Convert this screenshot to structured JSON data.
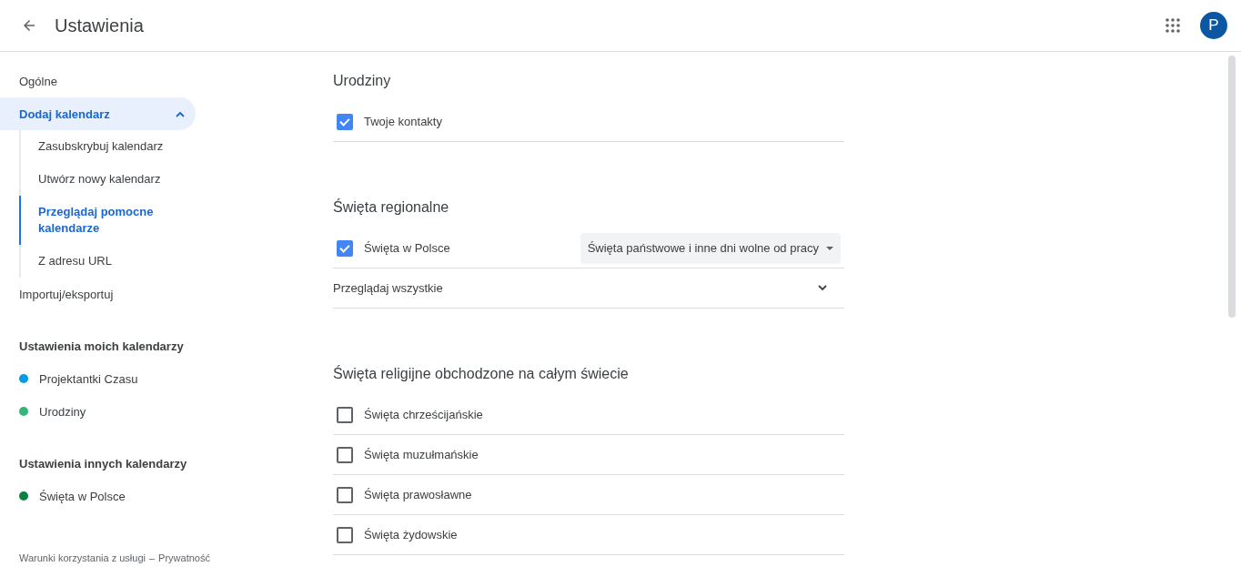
{
  "header": {
    "title": "Ustawienia",
    "avatar": "P"
  },
  "sidebar": {
    "items": [
      {
        "kind": "link",
        "label": "Ogólne",
        "selected": false
      },
      {
        "kind": "group",
        "label": "Dodaj kalendarz",
        "selected": true,
        "expanded": true,
        "children": [
          {
            "label": "Zasubskrybuj kalendarz",
            "selected": false
          },
          {
            "label": "Utwórz nowy kalendarz",
            "selected": false
          },
          {
            "label": "Przeglądaj pomocne kalendarze",
            "selected": true
          },
          {
            "label": "Z adresu URL",
            "selected": false
          }
        ]
      },
      {
        "kind": "link",
        "label": "Importuj/eksportuj",
        "selected": false
      }
    ],
    "sections": [
      {
        "title": "Ustawienia moich kalendarzy",
        "calendars": [
          {
            "label": "Projektantki Czasu",
            "color": "#039be5"
          },
          {
            "label": "Urodziny",
            "color": "#33b679"
          }
        ]
      },
      {
        "title": "Ustawienia innych kalendarzy",
        "calendars": [
          {
            "label": "Święta w Polsce",
            "color": "#0b8043"
          }
        ]
      }
    ],
    "footer": {
      "terms": "Warunki korzystania z usługi",
      "separator": "–",
      "privacy": "Prywatność"
    }
  },
  "main": {
    "sections": [
      {
        "title": "Urodziny",
        "rows": [
          {
            "kind": "checkbox",
            "label": "Twoje kontakty",
            "checked": true
          }
        ]
      },
      {
        "title": "Święta regionalne",
        "rows": [
          {
            "kind": "checkbox",
            "label": "Święta w Polsce",
            "checked": true,
            "dropdown": "Święta państwowe i inne dni wolne od pracy"
          },
          {
            "kind": "expander",
            "label": "Przeglądaj wszystkie",
            "expanded": false
          }
        ]
      },
      {
        "title": "Święta religijne obchodzone na całym świecie",
        "rows": [
          {
            "kind": "checkbox",
            "label": "Święta chrześcijańskie",
            "checked": false
          },
          {
            "kind": "checkbox",
            "label": "Święta muzułmańskie",
            "checked": false
          },
          {
            "kind": "checkbox",
            "label": "Święta prawosławne",
            "checked": false
          },
          {
            "kind": "checkbox",
            "label": "Święta żydowskie",
            "checked": false
          }
        ]
      }
    ]
  }
}
